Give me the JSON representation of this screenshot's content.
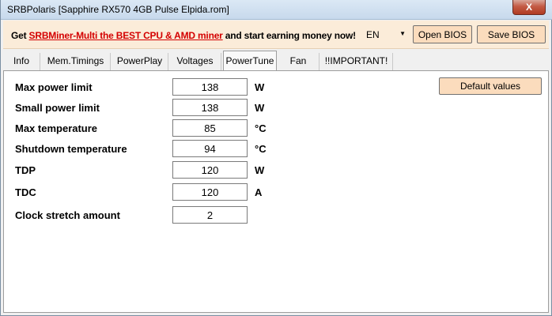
{
  "window": {
    "title": "SRBPolaris [Sapphire RX570 4GB Pulse Elpida.rom]",
    "close_label": "X"
  },
  "promo": {
    "prefix": "Get ",
    "link": "SRBMiner-Multi the BEST CPU & AMD miner",
    "suffix": " and start earning money now!",
    "language": "EN"
  },
  "toolbar": {
    "open_label": "Open BIOS",
    "save_label": "Save BIOS"
  },
  "tabs": [
    {
      "label": "Info"
    },
    {
      "label": "Mem.Timings"
    },
    {
      "label": "PowerPlay"
    },
    {
      "label": "Voltages"
    },
    {
      "label": "PowerTune",
      "active": true
    },
    {
      "label": "Fan"
    },
    {
      "label": "!!IMPORTANT!"
    }
  ],
  "powertune": {
    "default_label": "Default values",
    "rows": [
      {
        "label": "Max power limit",
        "value": "138",
        "unit": "W"
      },
      {
        "label": "Small power limit",
        "value": "138",
        "unit": "W"
      },
      {
        "label": "Max temperature",
        "value": "85",
        "unit": "°C"
      },
      {
        "label": "Shutdown temperature",
        "value": "94",
        "unit": "°C"
      },
      {
        "label": "TDP",
        "value": "120",
        "unit": "W"
      },
      {
        "label": "TDC",
        "value": "120",
        "unit": "A"
      },
      {
        "label": "Clock stretch amount",
        "value": "2",
        "unit": ""
      }
    ]
  },
  "colors": {
    "promo_bg": "#fbecd9",
    "button_bg": "#fbdcbd",
    "link": "#d40000"
  }
}
